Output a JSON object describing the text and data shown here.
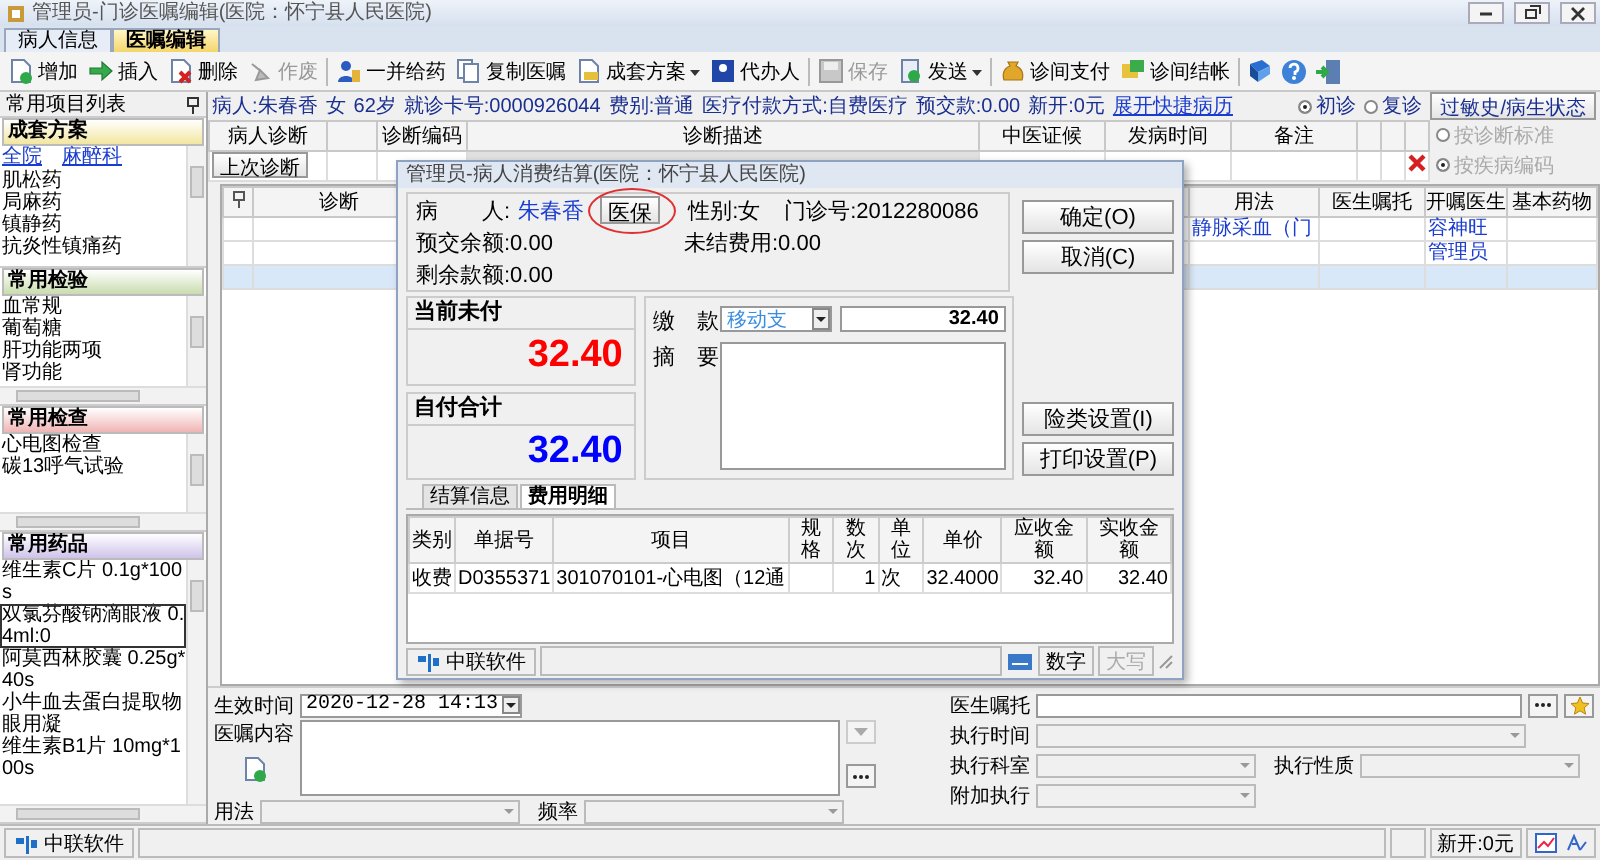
{
  "window": {
    "title": "管理员-门诊医嘱编辑(医院：怀宁县人民医院)"
  },
  "tabs": [
    {
      "label": "病人信息",
      "selected": false
    },
    {
      "label": "医嘱编辑",
      "selected": true
    }
  ],
  "toolbar": [
    {
      "label": "增加",
      "disabled": false,
      "dropdown": false
    },
    {
      "label": "插入",
      "disabled": false,
      "dropdown": false
    },
    {
      "label": "删除",
      "disabled": false,
      "dropdown": false
    },
    {
      "label": "作废",
      "disabled": true,
      "dropdown": false
    },
    {
      "label": "一并给药",
      "disabled": false,
      "dropdown": false
    },
    {
      "label": "复制医嘱",
      "disabled": false,
      "dropdown": false
    },
    {
      "label": "成套方案",
      "disabled": false,
      "dropdown": true
    },
    {
      "label": "代办人",
      "disabled": false,
      "dropdown": false
    },
    {
      "label": "保存",
      "disabled": true,
      "dropdown": false
    },
    {
      "label": "发送",
      "disabled": false,
      "dropdown": true
    },
    {
      "label": "诊间支付",
      "disabled": false,
      "dropdown": false
    },
    {
      "label": "诊间结帐",
      "disabled": false,
      "dropdown": false
    }
  ],
  "sidebar": {
    "title": "常用项目列表",
    "sections": [
      {
        "title": "成套方案",
        "color": "#f3e6a0",
        "links": [
          "全院",
          "麻醉科"
        ],
        "items": [
          {
            "label": "肌松药",
            "selected": false
          },
          {
            "label": "局麻药",
            "selected": false
          },
          {
            "label": "镇静药",
            "selected": false
          },
          {
            "label": "抗炎性镇痛药",
            "selected": false
          }
        ]
      },
      {
        "title": "常用检验",
        "color": "#c9dcae",
        "items": [
          {
            "label": "血常规",
            "selected": false
          },
          {
            "label": "葡萄糖",
            "selected": false
          },
          {
            "label": "肝功能两项",
            "selected": false
          },
          {
            "label": "肾功能",
            "selected": false
          }
        ]
      },
      {
        "title": "常用检查",
        "color": "#f0b4b4",
        "items": [
          {
            "label": "心电图检查",
            "selected": false
          },
          {
            "label": "碳13呼气试验",
            "selected": false
          }
        ]
      },
      {
        "title": "常用药品",
        "color": "#cfc3ea",
        "items": [
          {
            "label": "维生素C片 0.1g*100s",
            "selected": false
          },
          {
            "label": "双氯芬酸钠滴眼液 0.4ml:0",
            "selected": true
          },
          {
            "label": "阿莫西林胶囊 0.25g*40s",
            "selected": false
          },
          {
            "label": "小牛血去蛋白提取物眼用凝",
            "selected": false
          },
          {
            "label": "维生素B1片 10mg*100s",
            "selected": false
          }
        ]
      }
    ]
  },
  "patient_bar": {
    "items": [
      "病人:朱春香",
      "女",
      "62岁",
      "就诊卡号:0000926044",
      "费别:普通",
      "医疗付款方式:自费医疗",
      "预交款:0.00",
      "新开:0元"
    ],
    "link": "展开快捷病历",
    "visit_type": [
      {
        "label": "初诊",
        "selected": true
      },
      {
        "label": "复诊",
        "selected": false
      }
    ],
    "button": "过敏史/病生状态"
  },
  "diagnosis": {
    "columns": [
      "病人诊断",
      "诊断编码",
      "诊断描述",
      "中医证候",
      "发病时间",
      "备注"
    ],
    "last_button": "上次诊断",
    "match_options": [
      {
        "label": "按诊断标准",
        "selected": false,
        "disabled": true
      },
      {
        "label": "按疾病编码",
        "selected": true,
        "disabled": true
      }
    ]
  },
  "orders": {
    "columns": [
      "诊断",
      "用法",
      "医生嘱托",
      "开嘱医生",
      "基本药物"
    ],
    "rows": [
      {
        "usage": "静脉采血（门",
        "doctor": "容神旺",
        "selected": false
      },
      {
        "doctor": "管理员",
        "selected": false
      },
      {
        "selected": true
      }
    ]
  },
  "order_form": {
    "fields": [
      {
        "kind": "datetime",
        "label": "生效时间",
        "value": "2020-12-28 14:13",
        "disabled": false
      },
      {
        "kind": "textarea",
        "label": "医嘱内容",
        "disabled": false
      },
      {
        "kind": "select",
        "label": "用法",
        "disabled": true
      },
      {
        "kind": "select",
        "label": "频率",
        "disabled": true
      },
      {
        "kind": "text",
        "label": "医生嘱托",
        "disabled": false
      },
      {
        "kind": "select",
        "label": "执行时间",
        "disabled": true
      },
      {
        "kind": "select",
        "label": "执行科室",
        "disabled": true
      },
      {
        "kind": "select",
        "label": "执行性质",
        "disabled": true
      },
      {
        "kind": "select",
        "label": "附加执行",
        "disabled": true
      }
    ]
  },
  "status_bar": {
    "brand": "中联软件",
    "new_orders": "新开:0元"
  },
  "settlement_dialog": {
    "title": "管理员-病人消费结算(医院：怀宁县人民医院)",
    "patient_label": "病　　人:",
    "patient_name": "朱春香",
    "insurance_button": {
      "label": "医保",
      "circled": true
    },
    "gender": "性别:女",
    "clinic_no": "门诊号:2012280086",
    "prepaid_balance": "预交余额:0.00",
    "unsettled": "未结费用:0.00",
    "remaining": "剩余款额:0.00",
    "amounts": [
      {
        "label": "当前未付",
        "value": "32.40",
        "color": "#ff0000"
      },
      {
        "label": "自付合计",
        "value": "32.40",
        "color": "#0000ff"
      }
    ],
    "payment": {
      "label": "缴　款",
      "method": "移动支",
      "amount": "32.40"
    },
    "summary_label": "摘　要",
    "buttons": [
      "确定(O)",
      "取消(C)"
    ],
    "setting_buttons": [
      "险类设置(I)",
      "打印设置(P)"
    ],
    "tabs": [
      {
        "label": "结算信息",
        "selected": false
      },
      {
        "label": "费用明细",
        "selected": true
      }
    ],
    "table": {
      "columns": [
        "类别",
        "单据号",
        "项目",
        "规格",
        "数次",
        "单位",
        "单价",
        "应收金额",
        "实收金额"
      ],
      "rows": [
        [
          "收费",
          "D0355371",
          "301070101-心电图（12通",
          null,
          "1",
          "次",
          "32.4000",
          "32.40",
          "32.40"
        ]
      ]
    },
    "status": {
      "brand": "中联软件",
      "panels": [
        {
          "label": "数字",
          "disabled": false
        },
        {
          "label": "大写",
          "disabled": true
        }
      ]
    }
  }
}
